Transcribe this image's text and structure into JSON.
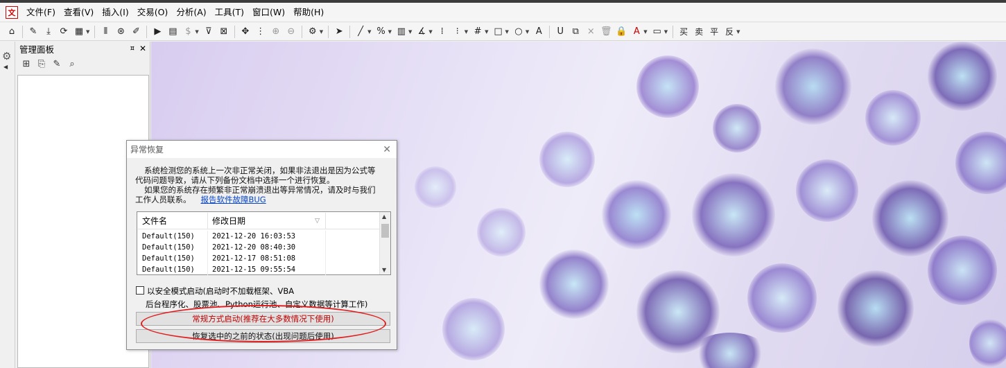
{
  "menubar": {
    "app_icon": "文",
    "items": [
      "文件(F)",
      "查看(V)",
      "插入(I)",
      "交易(O)",
      "分析(A)",
      "工具(T)",
      "窗口(W)",
      "帮助(H)"
    ]
  },
  "toolbar": {
    "glyphs": [
      "⌂",
      "✎",
      "⤓",
      "⟳",
      "▦",
      "⫴",
      "⊛",
      "✐",
      "▶",
      "▤",
      "$",
      "⊽",
      "⊠",
      "✥",
      "⋮",
      "⊕",
      "⊖",
      "⚙",
      "➤",
      "╱",
      "%",
      "▥",
      "∡",
      "⁞",
      "⁝",
      "#",
      "□",
      "○",
      "A",
      "U",
      "⧉",
      "×",
      "🗑",
      "🔒",
      "A",
      "▭",
      "买",
      "卖",
      "平",
      "反"
    ]
  },
  "panel": {
    "title": "管理面板",
    "pin": "⯏",
    "close": "✕"
  },
  "dialog": {
    "title": "异常恢复",
    "close": "✕",
    "message_line1": "系统检测您的系统上一次非正常关闭，如果非法退出是因为公式等",
    "message_line2": "代码问题导致，请从下列备份文档中选择一个进行恢复。",
    "message_line3": "如果您的系统存在频繁非正常崩溃退出等异常情况，请及时与我们",
    "message_line4": "工作人员联系。",
    "link": "报告软件故障BUG",
    "columns": [
      "文件名",
      "修改日期",
      ""
    ],
    "rows": [
      [
        "Default(150)",
        "2021-12-20 16:03:53"
      ],
      [
        "Default(150)",
        "2021-12-20 08:40:30"
      ],
      [
        "Default(150)",
        "2021-12-17 08:51:08"
      ],
      [
        "Default(150)",
        "2021-12-15 09:55:54"
      ]
    ],
    "safe_mode_line1": "以安全模式启动(启动时不加载框架、VBA",
    "safe_mode_line2": "后台程序化、股票池、Python运行池、自定义数据等计算工作)",
    "btn_normal": "常规方式启动(推荐在大多数情况下使用)",
    "btn_restore": "恢复选中的之前的状态(出现问题后使用)"
  },
  "colors": {
    "annotation_circle": "#e02020",
    "normal_button_text": "#c00000",
    "link": "#0645c8"
  }
}
